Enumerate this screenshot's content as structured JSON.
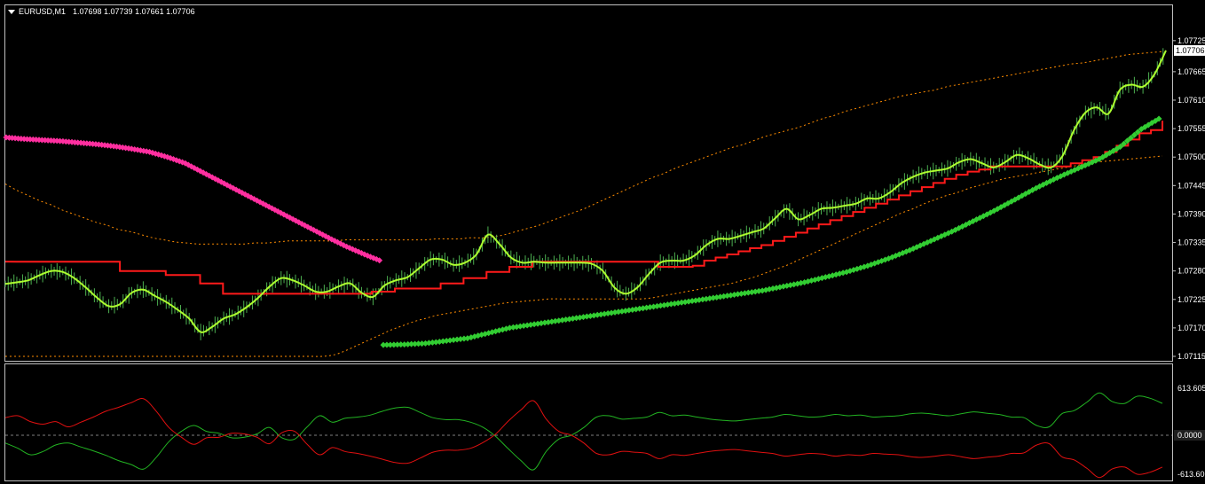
{
  "header": {
    "symbol": "EURUSD,M1",
    "ohlc": "1.07698 1.07739 1.07661 1.07706"
  },
  "colors": {
    "background": "#000000",
    "frame": "#c0c0c0",
    "price_line": "#adff2f",
    "bar_ticks": "#4caf50",
    "step_line": "#ff1a1a",
    "magenta_dots": "#ff2fa0",
    "green_dots": "#32cd32",
    "band": "#ff8c00",
    "osc_green": "#22b322",
    "osc_red": "#e01010",
    "zero_line": "#808080"
  },
  "price_axis": {
    "ticks": [
      "1.07725",
      "1.07665",
      "1.07610",
      "1.07555",
      "1.07500",
      "1.07445",
      "1.07390",
      "1.07335",
      "1.07280",
      "1.07225",
      "1.07170",
      "1.07115"
    ],
    "current_price": "1.07706"
  },
  "oscillator_axis": {
    "ticks": [
      "613.605",
      "0.0000",
      "-613.60"
    ]
  },
  "chart_data": [
    {
      "type": "line",
      "title": "EURUSD,M1 1.07698 1.07739 1.07661 1.07706",
      "xlabel": "",
      "ylabel": "",
      "ylim": [
        1.07115,
        1.07735
      ],
      "grid": false,
      "series": [
        {
          "role": "price",
          "color": "#adff2f",
          "values": [
            1.07255,
            1.07258,
            1.07262,
            1.07272,
            1.0728,
            1.07278,
            1.07266,
            1.07248,
            1.07228,
            1.07212,
            1.07216,
            1.07238,
            1.07244,
            1.07232,
            1.0722,
            1.07205,
            1.07188,
            1.07162,
            1.07172,
            1.07188,
            1.07196,
            1.0721,
            1.07228,
            1.0725,
            1.07266,
            1.07262,
            1.07252,
            1.0724,
            1.0724,
            1.0725,
            1.07256,
            1.07238,
            1.0723,
            1.07252,
            1.07262,
            1.07268,
            1.07285,
            1.07302,
            1.07302,
            1.07292,
            1.07296,
            1.07312,
            1.0735,
            1.07332,
            1.07306,
            1.07296,
            1.07298,
            1.07296,
            1.07296,
            1.07296,
            1.07296,
            1.07294,
            1.0728,
            1.07248,
            1.07236,
            1.07248,
            1.07274,
            1.07296,
            1.073,
            1.073,
            1.0731,
            1.0733,
            1.07342,
            1.07342,
            1.07348,
            1.07355,
            1.07362,
            1.07382,
            1.074,
            1.0738,
            1.07388,
            1.074,
            1.07402,
            1.07406,
            1.0741,
            1.0742,
            1.0742,
            1.07432,
            1.0745,
            1.07462,
            1.0747,
            1.07474,
            1.07478,
            1.0749,
            1.07496,
            1.07488,
            1.0748,
            1.0749,
            1.07504,
            1.07498,
            1.07486,
            1.0748,
            1.07502,
            1.07552,
            1.07586,
            1.07596,
            1.07584,
            1.0763,
            1.0764,
            1.07636,
            1.0766,
            1.07706
          ]
        },
        {
          "role": "step",
          "color": "#ff1a1a",
          "values": [
            1.07298,
            1.07298,
            1.07298,
            1.07298,
            1.07298,
            1.07298,
            1.07298,
            1.07298,
            1.07298,
            1.07298,
            1.0728,
            1.0728,
            1.0728,
            1.0728,
            1.07272,
            1.07272,
            1.07272,
            1.07256,
            1.07256,
            1.07236,
            1.07236,
            1.07236,
            1.07236,
            1.07236,
            1.07236,
            1.07236,
            1.07236,
            1.07236,
            1.07236,
            1.07236,
            1.07236,
            1.07236,
            1.0724,
            1.0724,
            1.07246,
            1.07246,
            1.07246,
            1.07246,
            1.07256,
            1.07256,
            1.07266,
            1.07266,
            1.07278,
            1.07278,
            1.07288,
            1.07288,
            1.07298,
            1.07298,
            1.07298,
            1.07298,
            1.07298,
            1.07298,
            1.07298,
            1.07298,
            1.07298,
            1.07298,
            1.07298,
            1.07288,
            1.07288,
            1.07288,
            1.0729,
            1.073,
            1.07306,
            1.07312,
            1.07318,
            1.07324,
            1.0733,
            1.07338,
            1.07346,
            1.07354,
            1.07362,
            1.0737,
            1.07378,
            1.07386,
            1.07394,
            1.07402,
            1.0741,
            1.07418,
            1.07426,
            1.07434,
            1.07442,
            1.0745,
            1.07458,
            1.07466,
            1.07472,
            1.07476,
            1.07482,
            1.07482,
            1.07482,
            1.07482,
            1.07482,
            1.07482,
            1.07482,
            1.07488,
            1.07494,
            1.075,
            1.0751,
            1.07522,
            1.07534,
            1.07546,
            1.07552,
            1.0757
          ]
        },
        {
          "role": "upper_band",
          "color": "#ff8c00",
          "values": [
            1.07448,
            1.07436,
            1.07426,
            1.07416,
            1.07408,
            1.07398,
            1.0739,
            1.07382,
            1.07374,
            1.07368,
            1.0736,
            1.07356,
            1.0735,
            1.07344,
            1.0734,
            1.07336,
            1.07334,
            1.07332,
            1.07332,
            1.07332,
            1.07332,
            1.07332,
            1.07334,
            1.07334,
            1.07336,
            1.07338,
            1.07338,
            1.07338,
            1.07338,
            1.07338,
            1.0734,
            1.0734,
            1.0734,
            1.0734,
            1.0734,
            1.0734,
            1.0734,
            1.0734,
            1.07342,
            1.07342,
            1.07342,
            1.07344,
            1.07344,
            1.07346,
            1.0735,
            1.07356,
            1.07362,
            1.07368,
            1.07376,
            1.07384,
            1.07392,
            1.074,
            1.0741,
            1.0742,
            1.0743,
            1.0744,
            1.0745,
            1.0746,
            1.07468,
            1.07478,
            1.07486,
            1.07494,
            1.07502,
            1.0751,
            1.07518,
            1.07524,
            1.07532,
            1.0754,
            1.07546,
            1.07552,
            1.07558,
            1.07566,
            1.07574,
            1.0758,
            1.07588,
            1.07594,
            1.076,
            1.07606,
            1.07612,
            1.07618,
            1.07622,
            1.07626,
            1.0763,
            1.07636,
            1.0764,
            1.07644,
            1.07648,
            1.07652,
            1.07656,
            1.0766,
            1.07664,
            1.07668,
            1.07672,
            1.07676,
            1.0768,
            1.07682,
            1.07686,
            1.0769,
            1.07694,
            1.07698,
            1.077,
            1.07702,
            1.07704
          ]
        },
        {
          "role": "lower_band",
          "color": "#ff8c00",
          "values": [
            1.07115,
            1.07115,
            1.07115,
            1.07115,
            1.07115,
            1.07115,
            1.07115,
            1.07115,
            1.07115,
            1.07115,
            1.07115,
            1.07115,
            1.07115,
            1.07115,
            1.07115,
            1.07115,
            1.07115,
            1.07115,
            1.07115,
            1.07115,
            1.07115,
            1.07115,
            1.07115,
            1.07115,
            1.07115,
            1.07115,
            1.07115,
            1.07115,
            1.07115,
            1.07118,
            1.07126,
            1.07136,
            1.07146,
            1.07156,
            1.07166,
            1.07174,
            1.07182,
            1.07188,
            1.07194,
            1.07198,
            1.07202,
            1.07206,
            1.0721,
            1.07214,
            1.07218,
            1.0722,
            1.07222,
            1.07224,
            1.07226,
            1.07226,
            1.07226,
            1.07226,
            1.07226,
            1.07226,
            1.07226,
            1.07226,
            1.07226,
            1.07228,
            1.07232,
            1.07236,
            1.0724,
            1.07244,
            1.07248,
            1.07252,
            1.07256,
            1.07262,
            1.07268,
            1.07276,
            1.07284,
            1.07292,
            1.07302,
            1.07312,
            1.07322,
            1.07332,
            1.07342,
            1.07352,
            1.07362,
            1.07372,
            1.07382,
            1.07392,
            1.074,
            1.0741,
            1.07418,
            1.07426,
            1.07432,
            1.0744,
            1.07446,
            1.07452,
            1.07458,
            1.07462,
            1.07466,
            1.0747,
            1.07474,
            1.07478,
            1.07482,
            1.07486,
            1.0749,
            1.07492,
            1.07494,
            1.07496,
            1.07498,
            1.075,
            1.07502
          ]
        },
        {
          "role": "magenta_dots",
          "color": "#ff2fa0",
          "values": [
            1.07538,
            1.07535,
            1.07533,
            1.07531,
            1.07528,
            1.07525,
            1.07521,
            1.07516,
            1.0751,
            1.075,
            1.07488,
            1.0747,
            1.07452,
            1.07434,
            1.07416,
            1.07398,
            1.0738,
            1.07362,
            1.07344,
            1.07327,
            1.07312,
            1.07298
          ]
        },
        {
          "role": "green_dots",
          "color": "#32cd32",
          "values": [
            1.07137,
            1.07138,
            1.0714,
            1.07145,
            1.0715,
            1.0716,
            1.0717,
            1.07176,
            1.07182,
            1.07188,
            1.07194,
            1.072,
            1.07206,
            1.07212,
            1.07218,
            1.07224,
            1.0723,
            1.07236,
            1.07242,
            1.0725,
            1.07258,
            1.07268,
            1.07278,
            1.0729,
            1.07304,
            1.0732,
            1.07338,
            1.07356,
            1.07376,
            1.07396,
            1.07418,
            1.0744,
            1.0746,
            1.07478,
            1.07496,
            1.0752,
            1.07554,
            1.07578
          ]
        }
      ]
    },
    {
      "type": "line",
      "title": "",
      "xlabel": "",
      "ylabel": "",
      "ylim": [
        -613.6,
        613.605
      ],
      "grid": false,
      "series": [
        {
          "role": "oscillator_green",
          "color": "#22b322",
          "values": [
            -120,
            -200,
            -300,
            -250,
            -150,
            -120,
            -180,
            -240,
            -310,
            -390,
            -450,
            -520,
            -340,
            -100,
            60,
            150,
            60,
            30,
            -40,
            -30,
            20,
            120,
            -40,
            -60,
            130,
            300,
            200,
            260,
            280,
            310,
            370,
            420,
            430,
            350,
            270,
            240,
            240,
            200,
            120,
            -20,
            -210,
            -390,
            -530,
            -250,
            -60,
            0,
            120,
            280,
            300,
            250,
            260,
            280,
            350,
            300,
            310,
            280,
            250,
            230,
            220,
            240,
            260,
            280,
            320,
            300,
            280,
            290,
            320,
            300,
            310,
            280,
            290,
            300,
            330,
            340,
            320,
            300,
            330,
            360,
            340,
            320,
            280,
            270,
            150,
            130,
            330,
            380,
            510,
            650,
            520,
            490,
            600,
            570,
            490
          ]
        },
        {
          "role": "oscillator_red",
          "color": "#e01010",
          "values": [
            270,
            300,
            210,
            170,
            210,
            130,
            200,
            280,
            370,
            430,
            500,
            560,
            370,
            120,
            -30,
            -140,
            -40,
            -30,
            30,
            20,
            -30,
            -130,
            40,
            60,
            -140,
            -300,
            -190,
            -250,
            -280,
            -320,
            -370,
            -420,
            -430,
            -350,
            -260,
            -230,
            -230,
            -200,
            -110,
            20,
            220,
            390,
            530,
            250,
            60,
            0,
            -120,
            -280,
            -300,
            -250,
            -260,
            -280,
            -360,
            -300,
            -310,
            -280,
            -250,
            -230,
            -220,
            -240,
            -260,
            -280,
            -320,
            -300,
            -280,
            -290,
            -320,
            -300,
            -310,
            -280,
            -290,
            -300,
            -330,
            -340,
            -320,
            -300,
            -330,
            -360,
            -340,
            -320,
            -280,
            -270,
            -150,
            -130,
            -330,
            -380,
            -510,
            -650,
            -520,
            -490,
            -600,
            -570,
            -490
          ]
        }
      ]
    }
  ]
}
